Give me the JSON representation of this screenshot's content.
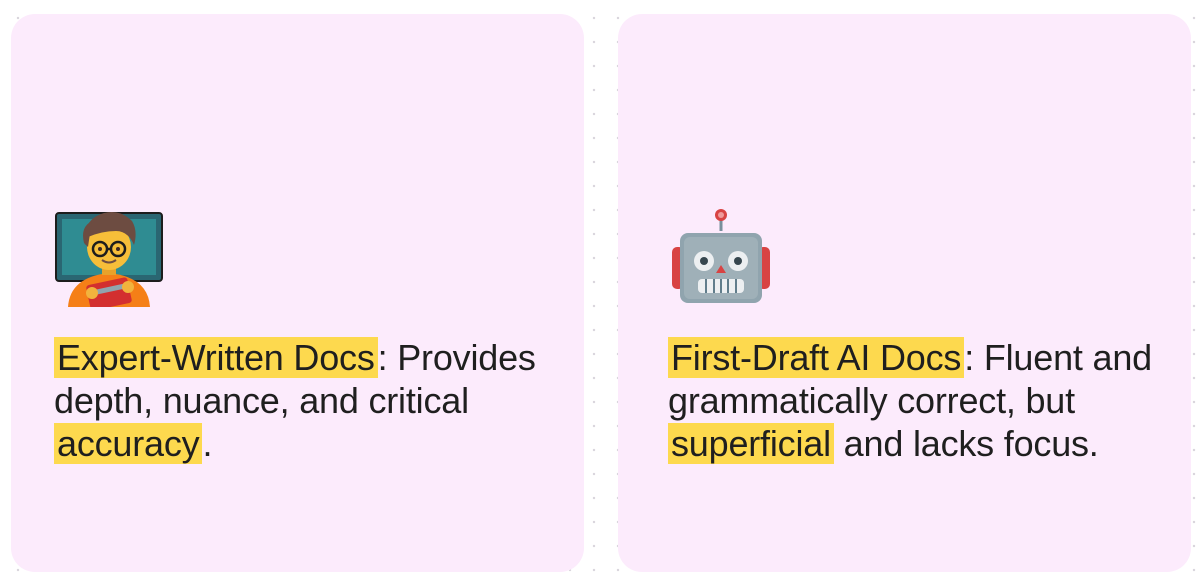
{
  "cards": [
    {
      "icon": "teacher-emoji-icon",
      "highlight": "Expert-Written Docs",
      "rest_1": ": Provides depth, nuance, and critical ",
      "highlight_2": "accuracy",
      "rest_2": "."
    },
    {
      "icon": "robot-emoji-icon",
      "highlight": "First-Draft AI Docs",
      "rest_1": ": Fluent and grammatically correct, but ",
      "highlight_2": "superficial",
      "rest_2": " and lacks focus."
    }
  ],
  "colors": {
    "card_bg": "#fcebfc",
    "highlight": "#fdd94e",
    "text": "#1f1f1f"
  }
}
